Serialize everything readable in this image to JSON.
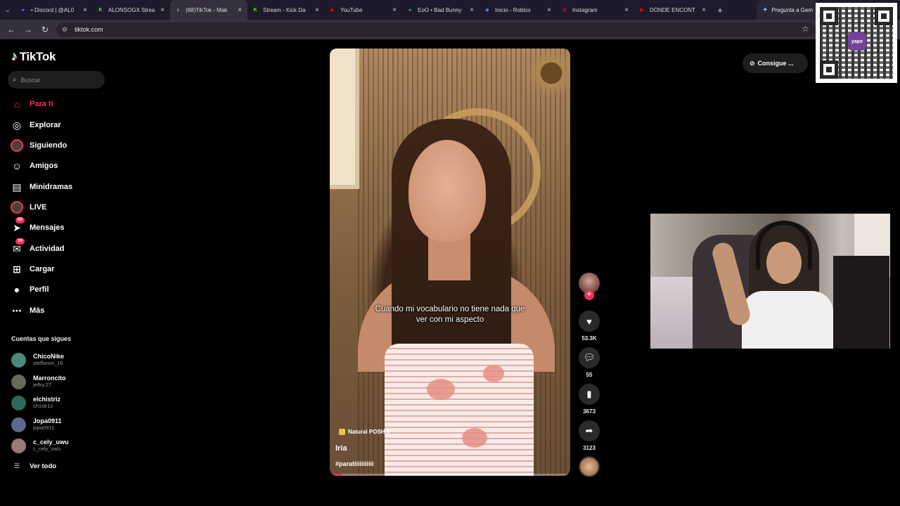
{
  "browser": {
    "tabs": [
      {
        "label": "• Discord | @AL0",
        "favicon": "discord",
        "color": "#5865f2",
        "active": false
      },
      {
        "label": "ALONSOGX Strea",
        "favicon": "kick",
        "color": "#53fc18",
        "active": false
      },
      {
        "label": "(88)TikTok - Mak",
        "favicon": "tiktok",
        "color": "#ffffff",
        "active": true
      },
      {
        "label": "Stream - Kick Da",
        "favicon": "kick",
        "color": "#53fc18",
        "active": false
      },
      {
        "label": "YouTube",
        "favicon": "youtube",
        "color": "#ff0000",
        "active": false
      },
      {
        "label": "EoO • Bad Bunny",
        "favicon": "spotify",
        "color": "#1db954",
        "active": false
      },
      {
        "label": "Inicio - Roblox",
        "favicon": "roblox",
        "color": "#4a7cf5",
        "active": false
      },
      {
        "label": "Instagram",
        "favicon": "instagram",
        "color": "#e1306c",
        "active": false
      },
      {
        "label": "DÓNDE ENCONT",
        "favicon": "youtube",
        "color": "#ff0000",
        "active": false
      }
    ],
    "gemini_tab": "Pregunta a Gem",
    "url": "tiktok.com"
  },
  "sidebar": {
    "logo": "TikTok",
    "search_placeholder": "Buscar",
    "nav": [
      {
        "label": "Para ti",
        "icon": "home-icon",
        "active": true
      },
      {
        "label": "Explorar",
        "icon": "compass-icon",
        "active": false
      },
      {
        "label": "Siguiendo",
        "icon": "following-icon",
        "active": false
      },
      {
        "label": "Amigos",
        "icon": "friends-icon",
        "active": false
      },
      {
        "label": "Minidramas",
        "icon": "film-icon",
        "active": false
      },
      {
        "label": "LIVE",
        "icon": "live-icon",
        "active": false
      },
      {
        "label": "Mensajes",
        "icon": "messages-icon",
        "badge": "69",
        "active": false
      },
      {
        "label": "Actividad",
        "icon": "activity-icon",
        "badge": "19",
        "active": false
      },
      {
        "label": "Cargar",
        "icon": "upload-icon",
        "active": false
      },
      {
        "label": "Perfil",
        "icon": "profile-icon",
        "active": false
      },
      {
        "label": "Más",
        "icon": "more-icon",
        "active": false
      }
    ],
    "following_title": "Cuentas que sigues",
    "following": [
      {
        "name": "ChicoNike",
        "user": "steffanox_16",
        "color": "#4a8a7a"
      },
      {
        "name": "Marroncito",
        "user": "jeffry.27",
        "color": "#6a6a5a"
      },
      {
        "name": "elchistriz",
        "user": "ch1str1z",
        "color": "#2a6a5a"
      },
      {
        "name": "Jopa0911",
        "user": "jopa0911",
        "color": "#5a6a8a"
      },
      {
        "name": "c_cely_uwu",
        "user": "c_cely_uwu",
        "color": "#9a7a7a"
      }
    ],
    "see_all": "Ver todo"
  },
  "video": {
    "caption": "Cuando mi vocabulario no tiene nada que ver con mi aspecto",
    "sound": "Natural POSH II",
    "author": "Iria",
    "tags": "#paratiiiiiiiiiii",
    "progress": 0.05
  },
  "actions": {
    "likes": "53.3K",
    "comments": "55",
    "saves": "3673",
    "shares": "3123"
  },
  "get_app": "Consigue ...",
  "qr": {
    "logo": "yape"
  }
}
